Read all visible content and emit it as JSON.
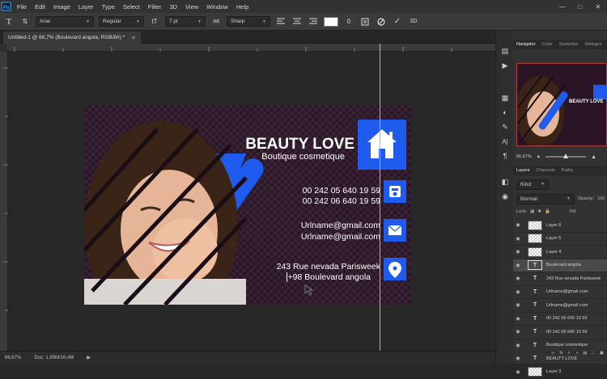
{
  "menu": [
    "File",
    "Edit",
    "Image",
    "Layer",
    "Type",
    "Select",
    "Filter",
    "3D",
    "View",
    "Window",
    "Help"
  ],
  "options": {
    "font_family": "Arial",
    "font_style": "Regular",
    "font_size": "7 pt",
    "anti_alias": "Sharp",
    "text_color": "#ffffff"
  },
  "document": {
    "tab_title": "Untitled-1 @ 66,7% (Boulevard angola, RGB/8#) *",
    "zoom": "66,67%",
    "doc_info": "Doc: 1,89M/16,4M"
  },
  "card": {
    "title": "BEAUTY LOVE",
    "subtitle": "Boutique cosmetique",
    "phone1": "00 242 05 640 19 59",
    "phone2": "00 242 06 640 19 59",
    "email1": "Urlname@gmail.com",
    "email2": "Urlname@gmail.com",
    "address1": "243 Rue nevada Parisweek",
    "address2": "+98 Boulevard angola",
    "accent": "#1f5bef",
    "background": "#2a1526"
  },
  "navigator": {
    "tabs": [
      "Navigator",
      "Color",
      "Swatches",
      "Histogra"
    ],
    "zoom": "66,67%"
  },
  "layers_panel": {
    "tabs": [
      "Layers",
      "Channels",
      "Paths"
    ],
    "kind_label": "Kind",
    "blend_mode": "Normal",
    "opacity_label": "Opacity:",
    "opacity_value": "100",
    "lock_label": "Lock:",
    "fill_label": "Fill:",
    "items": [
      {
        "name": "Layer 6",
        "type": "pixel"
      },
      {
        "name": "Layer 5",
        "type": "pixel"
      },
      {
        "name": "Layer 4",
        "type": "pixel"
      },
      {
        "name": "Boulevard angola",
        "type": "text",
        "selected": true
      },
      {
        "name": "243 Rue nevada Parisweek",
        "type": "text"
      },
      {
        "name": "Urlname@gmail.com",
        "type": "text"
      },
      {
        "name": "Urlname@gmail.com",
        "type": "text"
      },
      {
        "name": "00 242 06 640 19 59",
        "type": "text"
      },
      {
        "name": "00 242 05 640 19 59",
        "type": "text"
      },
      {
        "name": "Boutique cosmetique",
        "type": "text"
      },
      {
        "name": "BEAUTY LOVE",
        "type": "text"
      },
      {
        "name": "Layer 3",
        "type": "pixel"
      }
    ]
  },
  "icons": [
    "photoshop-logo-icon",
    "text-tool-icon",
    "text-orientation-icon",
    "align-left-icon",
    "align-center-icon",
    "align-right-icon",
    "warp-text-icon",
    "character-panel-icon",
    "cancel-icon",
    "commit-icon",
    "3d-icon",
    "home-icon",
    "phone-icon",
    "mail-icon",
    "location-pin-icon",
    "eye-icon"
  ]
}
